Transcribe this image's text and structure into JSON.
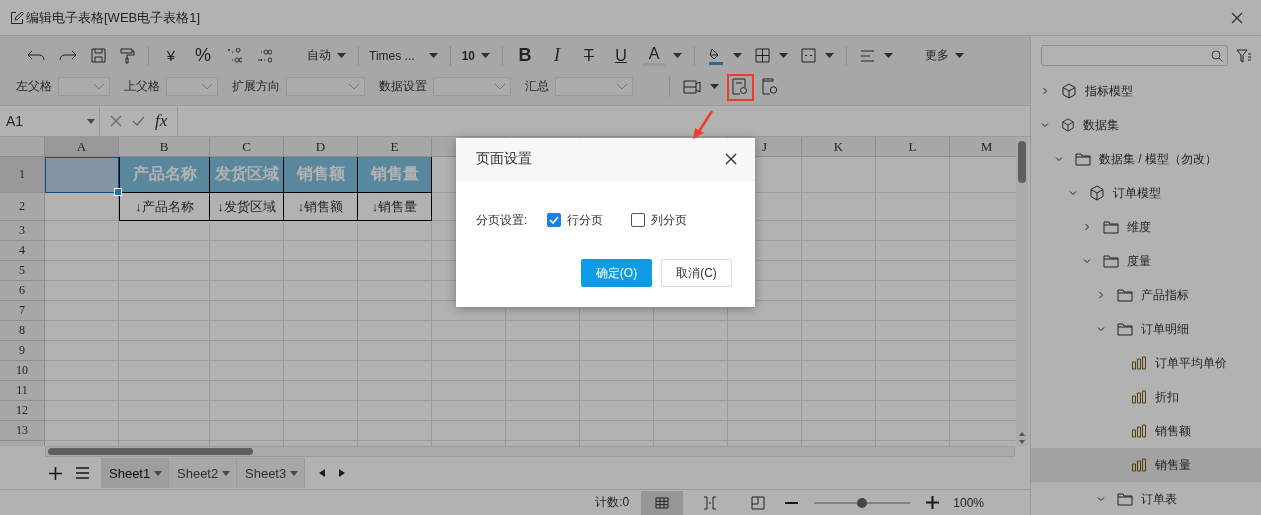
{
  "window": {
    "title": "编辑电子表格[WEB电子表格1]"
  },
  "toolbar": {
    "currency": "¥",
    "percent": "%",
    "number_format": "自动",
    "font": "Times ...",
    "font_size": "10",
    "bold": "B",
    "italic": "I",
    "strike": "T",
    "underline": "U",
    "font_color": "A",
    "more": "更多"
  },
  "fields": [
    {
      "label": "左父格"
    },
    {
      "label": "上父格"
    },
    {
      "label": "扩展方向"
    },
    {
      "label": "数据设置"
    },
    {
      "label": "汇总"
    }
  ],
  "formula_bar": {
    "cell_ref": "A1",
    "fx": "fx"
  },
  "sheet": {
    "columns": [
      {
        "label": "A"
      },
      {
        "label": "B"
      },
      {
        "label": "C"
      },
      {
        "label": "D"
      },
      {
        "label": "E"
      },
      {},
      {},
      {},
      {},
      {
        "label": "J"
      },
      {
        "label": "K"
      },
      {
        "label": "L"
      },
      {
        "label": "M"
      }
    ],
    "rows": [
      {
        "label": "1",
        "cells": [
          {
            "selected": true
          },
          {
            "text": "产品名称",
            "kind": "title",
            "selected": false
          },
          {
            "text": "发货区域",
            "kind": "title",
            "selected": false
          },
          {
            "text": "销售额",
            "kind": "title",
            "selected": false
          },
          {
            "text": "销售量",
            "kind": "title",
            "selected": false
          }
        ]
      },
      {
        "label": "2",
        "cells": [
          {
            "selected": false
          },
          {
            "text": "↓产品名称",
            "kind": "field",
            "selected": false
          },
          {
            "text": "↓发货区域",
            "kind": "field",
            "selected": false
          },
          {
            "text": "↓销售额",
            "kind": "field",
            "selected": false
          },
          {
            "text": "↓销售量",
            "kind": "field",
            "selected": false
          }
        ]
      },
      {
        "label": "3"
      },
      {
        "label": "4"
      },
      {
        "label": "5"
      },
      {
        "label": "6"
      },
      {
        "label": "7"
      },
      {
        "label": "8"
      },
      {
        "label": "9"
      },
      {
        "label": "10"
      },
      {
        "label": "11"
      },
      {
        "label": "12"
      },
      {
        "label": "13"
      }
    ]
  },
  "sheet_tabs": [
    {
      "label": "Sheet1",
      "selected": true
    },
    {
      "label": "Sheet2",
      "selected": false
    },
    {
      "label": "Sheet3",
      "selected": false
    }
  ],
  "status_bar": {
    "count": "计数:0",
    "view_modes": [
      {
        "kind": "normal",
        "selected": true
      },
      {
        "kind": "page-break",
        "selected": false
      },
      {
        "kind": "page-layout",
        "selected": false
      }
    ],
    "zoom": {
      "level": 0.5
    },
    "zoom_text": "100%"
  },
  "tree": {
    "items": [
      {
        "name": "指标模型",
        "kind": "model",
        "expanded": false,
        "selected": false
      },
      {
        "name": "数据集",
        "kind": "dataset",
        "expanded": true,
        "selected": false,
        "children": [
          {
            "name": "数据集 / 模型（勿改）",
            "kind": "folder",
            "expanded": true,
            "selected": false,
            "children": [
              {
                "name": "订单模型",
                "kind": "model",
                "expanded": true,
                "selected": false,
                "children": [
                  {
                    "name": "维度",
                    "kind": "folder",
                    "expanded": false,
                    "selected": false
                  },
                  {
                    "name": "度量",
                    "kind": "folder",
                    "expanded": true,
                    "selected": false,
                    "children": [
                      {
                        "name": "产品指标",
                        "kind": "folder",
                        "expanded": false,
                        "selected": false
                      },
                      {
                        "name": "订单明细",
                        "kind": "folder",
                        "expanded": true,
                        "selected": false,
                        "children": [
                          {
                            "name": "订单平均单价",
                            "kind": "measure",
                            "selected": false
                          },
                          {
                            "name": "折扣",
                            "kind": "measure",
                            "selected": false
                          },
                          {
                            "name": "销售额",
                            "kind": "measure",
                            "selected": false
                          },
                          {
                            "name": "销售量",
                            "kind": "measure",
                            "selected": true
                          }
                        ]
                      },
                      {
                        "name": "订单表",
                        "kind": "folder",
                        "expanded": true,
                        "selected": false
                      }
                    ]
                  }
                ]
              }
            ]
          }
        ]
      }
    ]
  },
  "dialog": {
    "title": "页面设置",
    "label": "分页设置:",
    "options": [
      {
        "label": "行分页",
        "checked": true
      },
      {
        "label": "列分页",
        "checked": false
      }
    ],
    "buttons": [
      {
        "label": "确定(O)",
        "kind": "primary"
      },
      {
        "label": "取消(C)",
        "kind": "default"
      }
    ]
  }
}
